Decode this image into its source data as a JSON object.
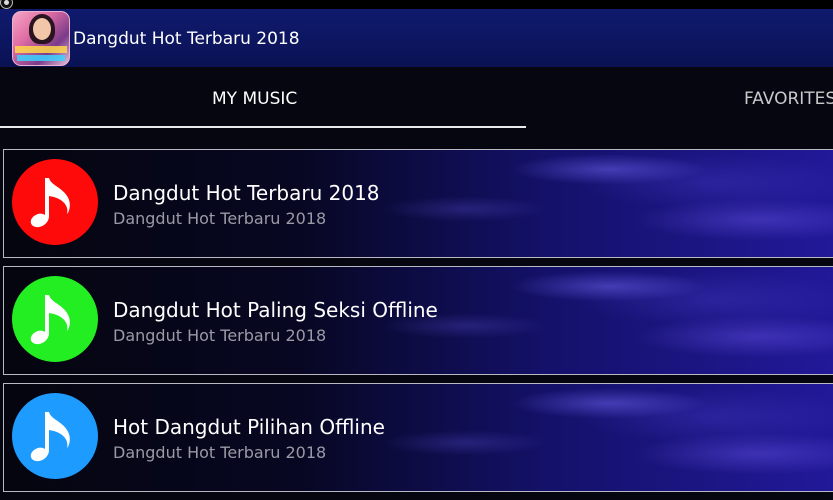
{
  "app": {
    "title": "Dangdut Hot Terbaru 2018",
    "icon": "app-logo-icon"
  },
  "tabs": [
    {
      "label": "MY MUSIC",
      "selected": true
    },
    {
      "label": "FAVORITES",
      "selected": false
    }
  ],
  "playlists": [
    {
      "title": "Dangdut Hot Terbaru 2018",
      "subtitle": "Dangdut Hot Terbaru 2018",
      "icon": "music-note-icon",
      "color": "#ff0a0a"
    },
    {
      "title": "Dangdut Hot Paling Seksi Offline",
      "subtitle": "Dangdut Hot Terbaru 2018",
      "icon": "music-note-icon",
      "color": "#22ee22"
    },
    {
      "title": "Hot Dangdut Pilihan Offline",
      "subtitle": "Dangdut Hot Terbaru 2018",
      "icon": "music-note-icon",
      "color": "#1e9bff"
    }
  ],
  "colors": {
    "appbar": "#0f1a6e",
    "background": "#05060f",
    "tab_indicator": "#e9e9ee"
  }
}
